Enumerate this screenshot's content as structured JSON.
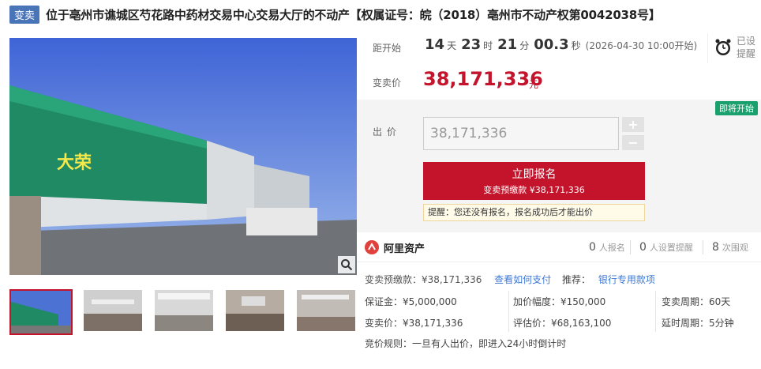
{
  "header": {
    "tag": "变卖",
    "title": "位于亳州市谯城区芍花路中药材交易中心交易大厅的不动产【权属证号：皖（2018）亳州市不动产权第0042038号】"
  },
  "timer": {
    "label": "距开始",
    "days": "14",
    "days_unit": "天",
    "hours": "23",
    "hours_unit": "时",
    "minutes": "21",
    "minutes_unit": "分",
    "seconds": "00.3",
    "seconds_unit": "秒",
    "start_note": "(2026-04-30 10:00开始)"
  },
  "remind": {
    "label": "已设提醒",
    "icon": "alarm-clock-icon"
  },
  "price": {
    "label": "变卖价",
    "value": "38,171,336",
    "unit": "元"
  },
  "bid": {
    "badge": "即将开始",
    "label": "出价",
    "input_value": "38,171,336",
    "plus": "+",
    "minus": "−",
    "signup_label": "立即报名",
    "signup_sub": "变卖预缴款 ¥38,171,336",
    "tip": "提醒：您还没有报名，报名成功后才能出价"
  },
  "stats": {
    "brand": "阿里资产",
    "signups": "0",
    "signups_label": "人报名",
    "reminders": "0",
    "reminders_label": "人设置提醒",
    "views": "8",
    "views_label": "次围观"
  },
  "details": {
    "deposit": "变卖预缴款：¥38,171,336",
    "how_to_pay": "查看如何支付",
    "recommend": "推荐：",
    "bank_loan": "银行专用款项",
    "bail": "保证金：¥5,000,000",
    "increment": "加价幅度：¥150,000",
    "period": "变卖周期：60天",
    "sell_price": "变卖价：¥38,171,336",
    "appraisal": "评估价：¥68,163,100",
    "delay": "延时周期：5分钟",
    "rule": "竞价规则：一旦有人出价，即进入24小时倒计时"
  },
  "colors": {
    "accent": "#c4142c",
    "tag": "#4a74b8",
    "badge": "#1aa06d",
    "link": "#3c78d8"
  }
}
